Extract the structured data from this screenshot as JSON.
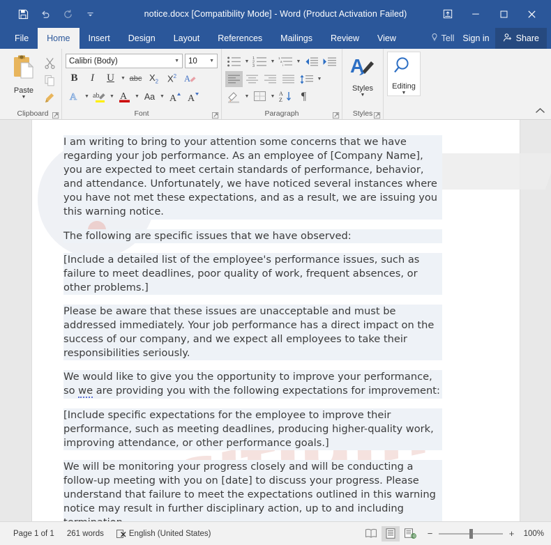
{
  "window": {
    "title": "notice.docx [Compatibility Mode] - Word (Product Activation Failed)",
    "accent_color": "#2b579a",
    "quick_access": [
      {
        "name": "save-icon",
        "label": "Save"
      },
      {
        "name": "undo-icon",
        "label": "Undo"
      },
      {
        "name": "redo-icon",
        "label": "Redo"
      },
      {
        "name": "customize-quick-access-icon",
        "label": "Customize Quick Access Toolbar"
      }
    ],
    "controls": [
      {
        "name": "ribbon-display-options-icon",
        "label": "Ribbon Display Options"
      },
      {
        "name": "minimize-icon",
        "label": "Minimize"
      },
      {
        "name": "maximize-icon",
        "label": "Maximize"
      },
      {
        "name": "close-icon",
        "label": "Close"
      }
    ]
  },
  "tabs": [
    {
      "label": "File",
      "active": false
    },
    {
      "label": "Home",
      "active": true
    },
    {
      "label": "Insert",
      "active": false
    },
    {
      "label": "Design",
      "active": false
    },
    {
      "label": "Layout",
      "active": false
    },
    {
      "label": "References",
      "active": false
    },
    {
      "label": "Mailings",
      "active": false
    },
    {
      "label": "Review",
      "active": false
    },
    {
      "label": "View",
      "active": false
    }
  ],
  "tab_right": {
    "tellme_label": "Tell ",
    "tellme_icon": "lightbulb-icon",
    "signin_label": "Sign in",
    "share_label": "Share",
    "share_icon": "person-add-icon"
  },
  "ribbon": {
    "collapse_label": "Collapse the Ribbon",
    "groups": [
      {
        "name": "clipboard",
        "label": "Clipboard",
        "paste_label": "Paste",
        "buttons": [
          {
            "name": "cut-icon",
            "label": "Cut"
          },
          {
            "name": "copy-icon",
            "label": "Copy"
          },
          {
            "name": "format-painter-icon",
            "label": "Format Painter"
          }
        ]
      },
      {
        "name": "font",
        "label": "Font",
        "font_name": "Calibri (Body)",
        "font_size": "10",
        "buttons": [
          {
            "name": "bold-icon",
            "label": "B"
          },
          {
            "name": "italic-icon",
            "label": "I"
          },
          {
            "name": "underline-icon",
            "label": "U"
          },
          {
            "name": "strikethrough-icon",
            "label": "abc"
          },
          {
            "name": "subscript-icon",
            "label": "X2"
          },
          {
            "name": "superscript-icon",
            "label": "X2"
          },
          {
            "name": "clear-formatting-icon",
            "label": "Clear All Formatting"
          },
          {
            "name": "text-effects-icon",
            "label": "Text Effects and Typography"
          },
          {
            "name": "text-highlight-color-icon",
            "label": "Text Highlight Color"
          },
          {
            "name": "font-color-icon",
            "label": "Font Color"
          },
          {
            "name": "change-case-icon",
            "label": "Aa"
          },
          {
            "name": "grow-font-icon",
            "label": "Increase Font Size"
          },
          {
            "name": "shrink-font-icon",
            "label": "Decrease Font Size"
          }
        ]
      },
      {
        "name": "paragraph",
        "label": "Paragraph",
        "buttons": [
          {
            "name": "bullets-icon",
            "label": "Bullets"
          },
          {
            "name": "numbering-icon",
            "label": "Numbering"
          },
          {
            "name": "multilevel-list-icon",
            "label": "Multilevel List"
          },
          {
            "name": "decrease-indent-icon",
            "label": "Decrease Indent"
          },
          {
            "name": "increase-indent-icon",
            "label": "Increase Indent"
          },
          {
            "name": "align-left-icon",
            "label": "Align Left",
            "active": true
          },
          {
            "name": "align-center-icon",
            "label": "Center"
          },
          {
            "name": "align-right-icon",
            "label": "Align Right"
          },
          {
            "name": "justify-icon",
            "label": "Justify"
          },
          {
            "name": "line-spacing-icon",
            "label": "Line and Paragraph Spacing"
          },
          {
            "name": "shading-icon",
            "label": "Shading"
          },
          {
            "name": "borders-icon",
            "label": "Borders"
          },
          {
            "name": "sort-icon",
            "label": "Sort"
          },
          {
            "name": "show-formatting-marks-icon",
            "label": "Show/Hide"
          }
        ]
      },
      {
        "name": "styles",
        "label": "Styles",
        "button_label": "Styles",
        "button_icon": "styles-icon"
      },
      {
        "name": "editing",
        "label": "",
        "button_label": "Editing",
        "button_icon": "search-icon"
      }
    ]
  },
  "document": {
    "paragraphs": [
      {
        "text": "I am writing to bring to your attention some concerns that we have regarding your job performance. As an employee of [Company Name], you are expected to meet certain standards of performance, behavior, and attendance. Unfortunately, we have noticed several instances where you have not met these expectations, and as a result, we are issuing you this warning notice."
      },
      {
        "text": "The following are specific issues that we have observed:"
      },
      {
        "text": "[Include a detailed list of the employee's performance issues, such as failure to meet deadlines, poor quality of work, frequent absences, or other problems.]"
      },
      {
        "text": "Please be aware that these issues are unacceptable and must be addressed immediately. Your job performance has a direct impact on the success of our company, and we expect all employees to take their responsibilities seriously."
      },
      {
        "text_before": "We would like to give you the opportunity to improve your performance, so ",
        "grammar_word": "we",
        "text_after": " are providing you with the following expectations for improvement:"
      },
      {
        "text": "[Include specific expectations for the employee to improve their performance, such as meeting deadlines, producing higher-quality work, improving attendance, or other performance goals.]"
      },
      {
        "text": "We will be monitoring your progress closely and will be conducting a follow-up meeting with you on [date] to discuss your progress. Please understand that failure to meet the expectations outlined in this warning notice may result in further disciplinary action, up to and including termination."
      }
    ],
    "watermark_text": "nsitium"
  },
  "statusbar": {
    "page": "Page 1 of 1",
    "words": "261 words",
    "proofing_icon": "spell-check-icon",
    "language": "English (United States)",
    "views": [
      {
        "name": "read-mode-icon",
        "label": "Read Mode",
        "active": false
      },
      {
        "name": "print-layout-icon",
        "label": "Print Layout",
        "active": true
      },
      {
        "name": "web-layout-icon",
        "label": "Web Layout",
        "active": false
      }
    ],
    "zoom_out_label": "−",
    "zoom_in_label": "+",
    "zoom_level": "100%"
  }
}
